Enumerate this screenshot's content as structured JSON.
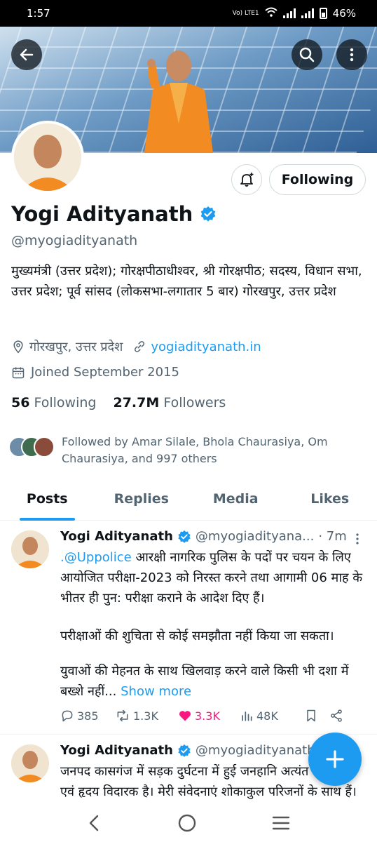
{
  "status_bar": {
    "time": "1:57",
    "network": "Vo) LTE1",
    "battery": "46%"
  },
  "colors": {
    "accent": "#1d9bf0",
    "verified": "#1d9bf0",
    "like": "#f91880",
    "text": "#0f1419",
    "muted": "#536471"
  },
  "header": {
    "back_icon": "arrow-left-icon",
    "search_icon": "search-icon",
    "more_icon": "more-vertical-icon"
  },
  "profile": {
    "name": "Yogi Adityanath",
    "handle": "@myogiadityanath",
    "bio": "मुख्यमंत्री (उत्तर प्रदेश); गोरक्षपीठाधीश्वर, श्री गोरक्षपीठ; सदस्य, विधान सभा, उत्तर प्रदेश; पूर्व सांसद (लोकसभा-लगातार 5 बार) गोरखपुर, उत्तर प्रदेश",
    "location": "गोरखपुर, उत्तर प्रदेश",
    "website": "yogiadityanath.in",
    "joined": "Joined September 2015",
    "following_count": "56",
    "following_label": "Following",
    "followers_count": "27.7M",
    "followers_label": "Followers",
    "followed_by": "Followed by Amar Silale, Bhola Chaurasiya, Om Chaurasiya, and 997 others",
    "follow_button": "Following"
  },
  "tabs": [
    {
      "label": "Posts",
      "active": true
    },
    {
      "label": "Replies",
      "active": false
    },
    {
      "label": "Media",
      "active": false
    },
    {
      "label": "Likes",
      "active": false
    }
  ],
  "posts": [
    {
      "name": "Yogi Adityanath",
      "handle": "@myogiadityana...",
      "time": "· 7m",
      "mention": ".@Uppolice",
      "text_a": " आरक्षी नागरिक पुलिस के पदों पर चयन के लिए आयोजित परीक्षा-2023 को निरस्त करने तथा आगामी 06 माह के भीतर ही पुन: परीक्षा कराने के आदेश दिए हैं।",
      "text_b": "परीक्षाओं की शुचिता से कोई समझौता नहीं किया जा सकता।",
      "text_c": "युवाओं की मेहनत के साथ खिलवाड़ करने वाले किसी भी दशा में बख्शे नहीं...",
      "show_more": "Show more",
      "replies": "385",
      "reposts": "1.3K",
      "likes": "3.3K",
      "views": "48K"
    },
    {
      "name": "Yogi Adityanath",
      "handle": "@myogiadityanath",
      "text": "जनपद कासगंज में सड़क दुर्घटना में हुई जनहानि अत्यंत ही दुःखद एवं हृदय विदारक है। मेरी संवेदनाएं शोकाकुल परिजनों के साथ हैं।"
    }
  ],
  "fab": {
    "icon": "plus-icon"
  },
  "navbar": {
    "back": "back-nav-icon",
    "home": "home-nav-icon",
    "recents": "recents-nav-icon"
  }
}
